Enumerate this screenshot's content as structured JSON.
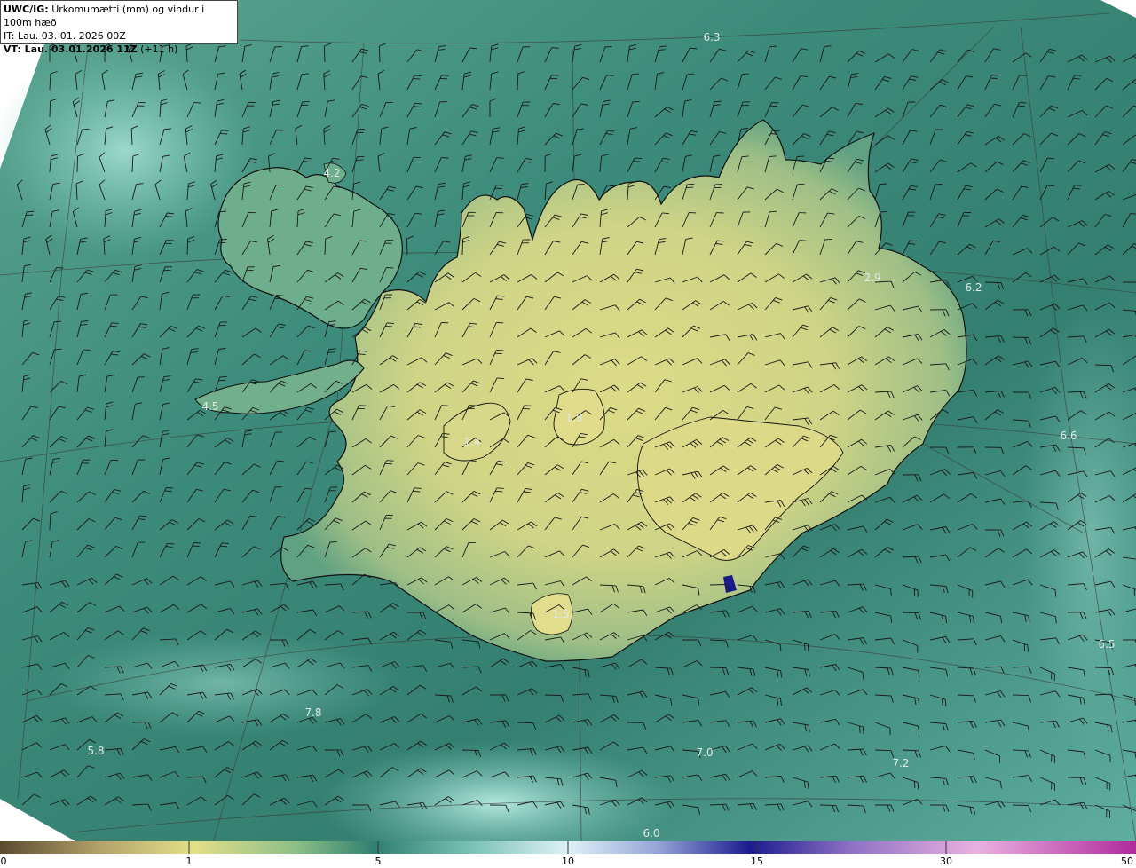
{
  "title": {
    "product": "UWC/IG:",
    "description": "Úrkomumætti (mm) og vindur i 100m hæð",
    "init_time": "IT: Lau. 03. 01. 2026 00Z",
    "valid_prefix": "VT: Lau. 03.01.2026 11Z",
    "valid_suffix": "(+11 h)"
  },
  "map_labels": [
    {
      "name": "label-6-3",
      "text": "6.3"
    },
    {
      "name": "label-4-2",
      "text": "4.2"
    },
    {
      "name": "label-2-9",
      "text": "2.9"
    },
    {
      "name": "label-6-2",
      "text": "6.2"
    },
    {
      "name": "label-4-5",
      "text": "4.5"
    },
    {
      "name": "label-1-4",
      "text": "1.4"
    },
    {
      "name": "label-1-8",
      "text": "1.8"
    },
    {
      "name": "label-6-6",
      "text": "6.6"
    },
    {
      "name": "label-1-5",
      "text": "1.5"
    },
    {
      "name": "label-6-5",
      "text": "6.5"
    },
    {
      "name": "label-7-8",
      "text": "7.8"
    },
    {
      "name": "label-5-8",
      "text": "5.8"
    },
    {
      "name": "label-7-0",
      "text": "7.0"
    },
    {
      "name": "label-7-2",
      "text": "7.2"
    },
    {
      "name": "label-6-0",
      "text": "6.0"
    }
  ],
  "colorbar": {
    "ticks": [
      "0",
      "1",
      "5",
      "10",
      "15",
      "30",
      "50"
    ],
    "colors": [
      "#6b5a3a",
      "#a99866",
      "#e3de86",
      "#6aa98c",
      "#2e7f6f",
      "#a3dedb",
      "#d8eef4",
      "#8ea0d4",
      "#1b1a8a",
      "#8c6fc1",
      "#e4a7dd",
      "#b0299a"
    ]
  },
  "colors": {
    "sea": "#3e8d7d",
    "sea_light": "#8fd3cd",
    "land_dry": "#d6d684",
    "coastline": "#111111"
  }
}
